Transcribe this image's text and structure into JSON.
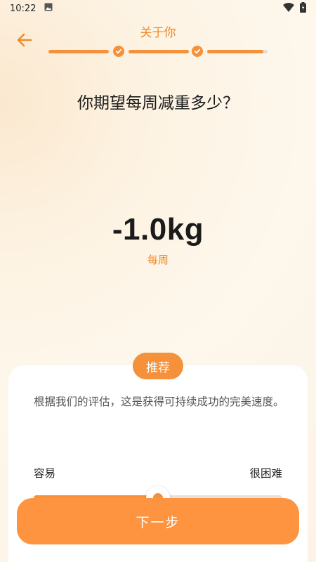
{
  "status_bar": {
    "time": "10:22",
    "icons": [
      "image-icon",
      "wifi-icon",
      "battery-icon"
    ]
  },
  "header": {
    "title": "关于你",
    "back_icon": "arrow-left-icon"
  },
  "progress": {
    "completed_steps": 2,
    "total_steps": 3,
    "current_step_fraction": 0.93
  },
  "question": "你期望每周减重多少？",
  "selection": {
    "value": "-1.0kg",
    "unit": "每周"
  },
  "recommendation": {
    "badge": "推荐",
    "description": "根据我们的评估，这是获得可持续成功的完美速度。",
    "easy_label": "容易",
    "hard_label": "很困难",
    "slider_fraction": 0.5
  },
  "footer": {
    "next_label": "下一步"
  },
  "colors": {
    "accent": "#f5913a",
    "button": "#ff9440",
    "text": "#1a1a1a"
  }
}
